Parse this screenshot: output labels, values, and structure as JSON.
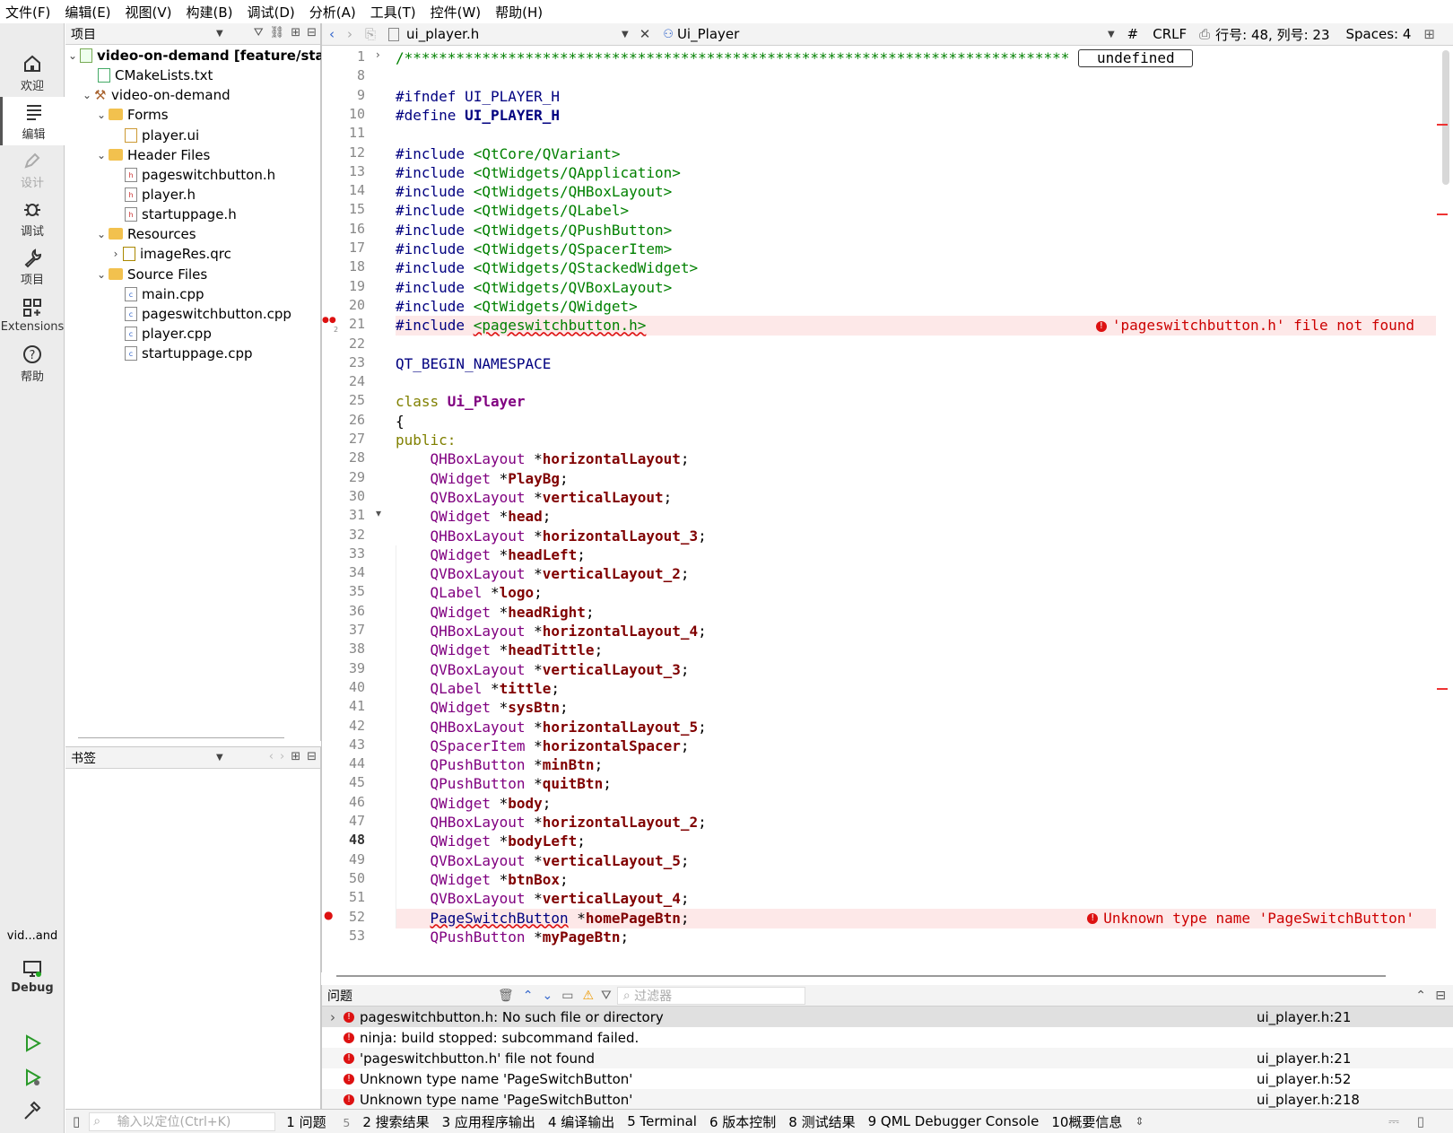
{
  "menu": [
    "文件(F)",
    "编辑(E)",
    "视图(V)",
    "构建(B)",
    "调试(D)",
    "分析(A)",
    "工具(T)",
    "控件(W)",
    "帮助(H)"
  ],
  "modes": {
    "welcome": "欢迎",
    "edit": "编辑",
    "design": "设计",
    "debug": "调试",
    "projects": "项目",
    "extensions": "Extensions",
    "help": "帮助",
    "kit_name": "vid...and",
    "kit_mode": "Debug"
  },
  "project_panel": {
    "title": "项目",
    "tree": [
      {
        "label": "video-on-demand [feature/star",
        "bold": true
      },
      {
        "label": "CMakeLists.txt"
      },
      {
        "label": "video-on-demand"
      },
      {
        "label": "Forms"
      },
      {
        "label": "player.ui"
      },
      {
        "label": "Header Files"
      },
      {
        "label": "pageswitchbutton.h"
      },
      {
        "label": "player.h"
      },
      {
        "label": "startuppage.h"
      },
      {
        "label": "Resources"
      },
      {
        "label": "imageRes.qrc"
      },
      {
        "label": "Source Files"
      },
      {
        "label": "main.cpp"
      },
      {
        "label": "pageswitchbutton.cpp"
      },
      {
        "label": "player.cpp"
      },
      {
        "label": "startuppage.cpp"
      }
    ]
  },
  "bookmarks_panel": {
    "title": "书签"
  },
  "editor_toolbar": {
    "file": "ui_player.h",
    "symbol": "Ui_Player",
    "hash": "#",
    "line_ending": "CRLF",
    "position": "行号: 48, 列号: 23",
    "spaces": "Spaces: 4"
  },
  "folded_comment": "...*/",
  "code": {
    "line_numbers": [
      "1",
      "8",
      "9",
      "10",
      "11",
      "12",
      "13",
      "14",
      "15",
      "16",
      "17",
      "18",
      "19",
      "20",
      "21",
      "22",
      "23",
      "24",
      "25",
      "26",
      "27",
      "28",
      "29",
      "30",
      "31",
      "32",
      "33",
      "34",
      "35",
      "36",
      "37",
      "38",
      "39",
      "40",
      "41",
      "42",
      "43",
      "44",
      "45",
      "46",
      "47",
      "48",
      "49",
      "50",
      "51",
      "52",
      "53"
    ],
    "line1": "/*****************************************************************************",
    "ifndef": "#ifndef",
    "define": "#define",
    "guard": "UI_PLAYER_H",
    "include_kw": "#include",
    "includes": [
      "<QtCore/QVariant>",
      "<QtWidgets/QApplication>",
      "<QtWidgets/QHBoxLayout>",
      "<QtWidgets/QLabel>",
      "<QtWidgets/QPushButton>",
      "<QtWidgets/QSpacerItem>",
      "<QtWidgets/QStackedWidget>",
      "<QtWidgets/QVBoxLayout>",
      "<QtWidgets/QWidget>",
      "<pageswitchbutton.h>"
    ],
    "ns_begin": "QT_BEGIN_NAMESPACE",
    "class_kw": "class",
    "class_name": "Ui_Player",
    "brace": "{",
    "public_kw": "public:",
    "members": [
      [
        "QHBoxLayout",
        "horizontalLayout"
      ],
      [
        "QWidget",
        "PlayBg"
      ],
      [
        "QVBoxLayout",
        "verticalLayout"
      ],
      [
        "QWidget",
        "head"
      ],
      [
        "QHBoxLayout",
        "horizontalLayout_3"
      ],
      [
        "QWidget",
        "headLeft"
      ],
      [
        "QVBoxLayout",
        "verticalLayout_2"
      ],
      [
        "QLabel",
        "logo"
      ],
      [
        "QWidget",
        "headRight"
      ],
      [
        "QHBoxLayout",
        "horizontalLayout_4"
      ],
      [
        "QWidget",
        "headTittle"
      ],
      [
        "QVBoxLayout",
        "verticalLayout_3"
      ],
      [
        "QLabel",
        "tittle"
      ],
      [
        "QWidget",
        "sysBtn"
      ],
      [
        "QHBoxLayout",
        "horizontalLayout_5"
      ],
      [
        "QSpacerItem",
        "horizontalSpacer"
      ],
      [
        "QPushButton",
        "minBtn"
      ],
      [
        "QPushButton",
        "quitBtn"
      ],
      [
        "QWidget",
        "body"
      ],
      [
        "QHBoxLayout",
        "horizontalLayout_2"
      ],
      [
        "QWidget",
        "bodyLeft"
      ],
      [
        "QVBoxLayout",
        "verticalLayout_5"
      ],
      [
        "QWidget",
        "btnBox"
      ],
      [
        "QVBoxLayout",
        "verticalLayout_4"
      ],
      [
        "PageSwitchButton",
        "homePageBtn"
      ],
      [
        "QPushButton",
        "myPageBtn"
      ]
    ],
    "error21": "'pageswitchbutton.h' file not found",
    "error52": "Unknown type name 'PageSwitchButton'",
    "err_count21": "2"
  },
  "issues": {
    "title": "问题",
    "filter_placeholder": "过滤器",
    "rows": [
      {
        "text": "pageswitchbutton.h: No such file or directory",
        "loc": "ui_player.h:21"
      },
      {
        "text": "ninja: build stopped: subcommand failed.",
        "loc": ""
      },
      {
        "text": "'pageswitchbutton.h' file not found",
        "loc": "ui_player.h:21"
      },
      {
        "text": "Unknown type name 'PageSwitchButton'",
        "loc": "ui_player.h:52"
      },
      {
        "text": "Unknown type name 'PageSwitchButton'",
        "loc": "ui_player.h:218"
      }
    ]
  },
  "statusbar": {
    "locator_placeholder": "输入以定位(Ctrl+K)",
    "tabs": [
      "1 问题",
      "2 搜索结果",
      "3 应用程序输出",
      "4 编译输出",
      "5 Terminal",
      "6 版本控制",
      "8 测试结果",
      "9 QML Debugger Console",
      "10概要信息"
    ],
    "issue_count": "5"
  },
  "colors": {
    "error": "#d11111",
    "preprocessor": "#000080",
    "string": "#008000",
    "keyword": "#808000",
    "type": "#800080",
    "identifier": "#800000"
  }
}
